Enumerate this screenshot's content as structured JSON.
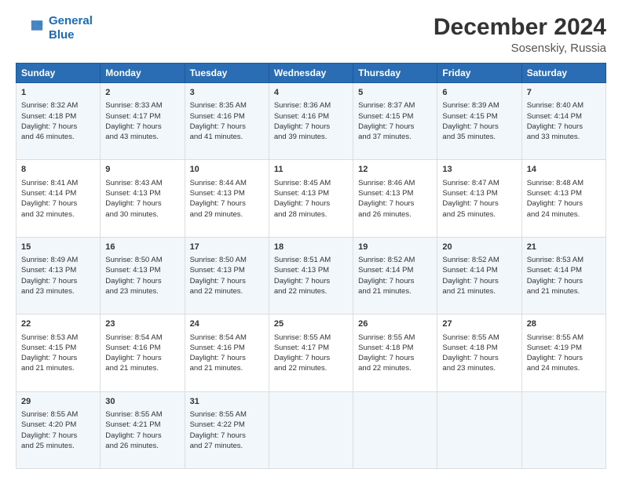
{
  "header": {
    "logo_line1": "General",
    "logo_line2": "Blue",
    "title": "December 2024",
    "subtitle": "Sosenskiy, Russia"
  },
  "columns": [
    "Sunday",
    "Monday",
    "Tuesday",
    "Wednesday",
    "Thursday",
    "Friday",
    "Saturday"
  ],
  "weeks": [
    [
      {
        "day": "1",
        "lines": [
          "Sunrise: 8:32 AM",
          "Sunset: 4:18 PM",
          "Daylight: 7 hours",
          "and 46 minutes."
        ]
      },
      {
        "day": "2",
        "lines": [
          "Sunrise: 8:33 AM",
          "Sunset: 4:17 PM",
          "Daylight: 7 hours",
          "and 43 minutes."
        ]
      },
      {
        "day": "3",
        "lines": [
          "Sunrise: 8:35 AM",
          "Sunset: 4:16 PM",
          "Daylight: 7 hours",
          "and 41 minutes."
        ]
      },
      {
        "day": "4",
        "lines": [
          "Sunrise: 8:36 AM",
          "Sunset: 4:16 PM",
          "Daylight: 7 hours",
          "and 39 minutes."
        ]
      },
      {
        "day": "5",
        "lines": [
          "Sunrise: 8:37 AM",
          "Sunset: 4:15 PM",
          "Daylight: 7 hours",
          "and 37 minutes."
        ]
      },
      {
        "day": "6",
        "lines": [
          "Sunrise: 8:39 AM",
          "Sunset: 4:15 PM",
          "Daylight: 7 hours",
          "and 35 minutes."
        ]
      },
      {
        "day": "7",
        "lines": [
          "Sunrise: 8:40 AM",
          "Sunset: 4:14 PM",
          "Daylight: 7 hours",
          "and 33 minutes."
        ]
      }
    ],
    [
      {
        "day": "8",
        "lines": [
          "Sunrise: 8:41 AM",
          "Sunset: 4:14 PM",
          "Daylight: 7 hours",
          "and 32 minutes."
        ]
      },
      {
        "day": "9",
        "lines": [
          "Sunrise: 8:43 AM",
          "Sunset: 4:13 PM",
          "Daylight: 7 hours",
          "and 30 minutes."
        ]
      },
      {
        "day": "10",
        "lines": [
          "Sunrise: 8:44 AM",
          "Sunset: 4:13 PM",
          "Daylight: 7 hours",
          "and 29 minutes."
        ]
      },
      {
        "day": "11",
        "lines": [
          "Sunrise: 8:45 AM",
          "Sunset: 4:13 PM",
          "Daylight: 7 hours",
          "and 28 minutes."
        ]
      },
      {
        "day": "12",
        "lines": [
          "Sunrise: 8:46 AM",
          "Sunset: 4:13 PM",
          "Daylight: 7 hours",
          "and 26 minutes."
        ]
      },
      {
        "day": "13",
        "lines": [
          "Sunrise: 8:47 AM",
          "Sunset: 4:13 PM",
          "Daylight: 7 hours",
          "and 25 minutes."
        ]
      },
      {
        "day": "14",
        "lines": [
          "Sunrise: 8:48 AM",
          "Sunset: 4:13 PM",
          "Daylight: 7 hours",
          "and 24 minutes."
        ]
      }
    ],
    [
      {
        "day": "15",
        "lines": [
          "Sunrise: 8:49 AM",
          "Sunset: 4:13 PM",
          "Daylight: 7 hours",
          "and 23 minutes."
        ]
      },
      {
        "day": "16",
        "lines": [
          "Sunrise: 8:50 AM",
          "Sunset: 4:13 PM",
          "Daylight: 7 hours",
          "and 23 minutes."
        ]
      },
      {
        "day": "17",
        "lines": [
          "Sunrise: 8:50 AM",
          "Sunset: 4:13 PM",
          "Daylight: 7 hours",
          "and 22 minutes."
        ]
      },
      {
        "day": "18",
        "lines": [
          "Sunrise: 8:51 AM",
          "Sunset: 4:13 PM",
          "Daylight: 7 hours",
          "and 22 minutes."
        ]
      },
      {
        "day": "19",
        "lines": [
          "Sunrise: 8:52 AM",
          "Sunset: 4:14 PM",
          "Daylight: 7 hours",
          "and 21 minutes."
        ]
      },
      {
        "day": "20",
        "lines": [
          "Sunrise: 8:52 AM",
          "Sunset: 4:14 PM",
          "Daylight: 7 hours",
          "and 21 minutes."
        ]
      },
      {
        "day": "21",
        "lines": [
          "Sunrise: 8:53 AM",
          "Sunset: 4:14 PM",
          "Daylight: 7 hours",
          "and 21 minutes."
        ]
      }
    ],
    [
      {
        "day": "22",
        "lines": [
          "Sunrise: 8:53 AM",
          "Sunset: 4:15 PM",
          "Daylight: 7 hours",
          "and 21 minutes."
        ]
      },
      {
        "day": "23",
        "lines": [
          "Sunrise: 8:54 AM",
          "Sunset: 4:16 PM",
          "Daylight: 7 hours",
          "and 21 minutes."
        ]
      },
      {
        "day": "24",
        "lines": [
          "Sunrise: 8:54 AM",
          "Sunset: 4:16 PM",
          "Daylight: 7 hours",
          "and 21 minutes."
        ]
      },
      {
        "day": "25",
        "lines": [
          "Sunrise: 8:55 AM",
          "Sunset: 4:17 PM",
          "Daylight: 7 hours",
          "and 22 minutes."
        ]
      },
      {
        "day": "26",
        "lines": [
          "Sunrise: 8:55 AM",
          "Sunset: 4:18 PM",
          "Daylight: 7 hours",
          "and 22 minutes."
        ]
      },
      {
        "day": "27",
        "lines": [
          "Sunrise: 8:55 AM",
          "Sunset: 4:18 PM",
          "Daylight: 7 hours",
          "and 23 minutes."
        ]
      },
      {
        "day": "28",
        "lines": [
          "Sunrise: 8:55 AM",
          "Sunset: 4:19 PM",
          "Daylight: 7 hours",
          "and 24 minutes."
        ]
      }
    ],
    [
      {
        "day": "29",
        "lines": [
          "Sunrise: 8:55 AM",
          "Sunset: 4:20 PM",
          "Daylight: 7 hours",
          "and 25 minutes."
        ]
      },
      {
        "day": "30",
        "lines": [
          "Sunrise: 8:55 AM",
          "Sunset: 4:21 PM",
          "Daylight: 7 hours",
          "and 26 minutes."
        ]
      },
      {
        "day": "31",
        "lines": [
          "Sunrise: 8:55 AM",
          "Sunset: 4:22 PM",
          "Daylight: 7 hours",
          "and 27 minutes."
        ]
      },
      {
        "day": "",
        "lines": []
      },
      {
        "day": "",
        "lines": []
      },
      {
        "day": "",
        "lines": []
      },
      {
        "day": "",
        "lines": []
      }
    ]
  ]
}
